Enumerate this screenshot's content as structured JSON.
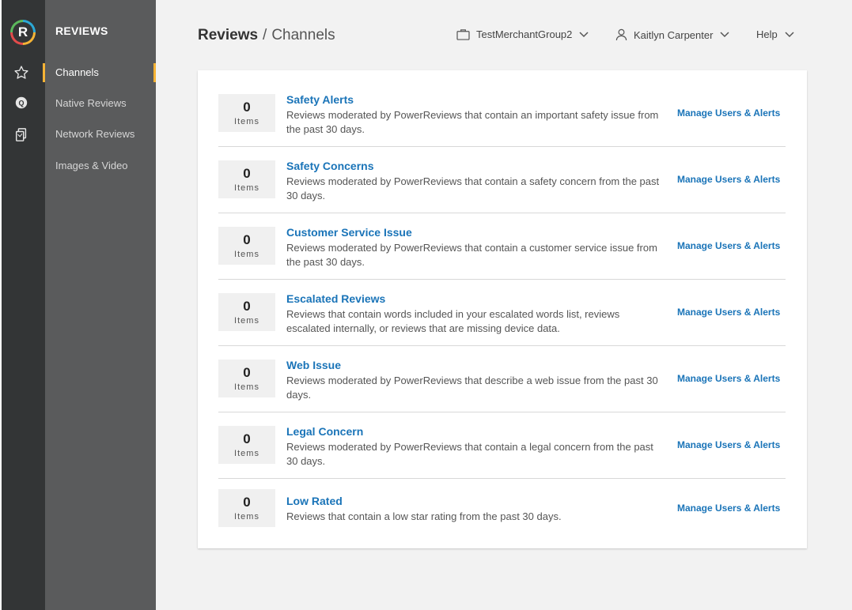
{
  "app": {
    "logo_letter": "R",
    "brand": "REVIEWS"
  },
  "nav": {
    "items": [
      {
        "label": "Channels",
        "active": true
      },
      {
        "label": "Native Reviews",
        "active": false
      },
      {
        "label": "Network Reviews",
        "active": false
      },
      {
        "label": "Images & Video",
        "active": false
      }
    ]
  },
  "header": {
    "title_main": "Reviews",
    "title_sep": "/",
    "title_sub": "Channels",
    "merchant": "TestMerchantGroup2",
    "user": "Kaitlyn Carpenter",
    "help": "Help"
  },
  "colors": {
    "accent": "#f5b335",
    "link": "#1a74b8",
    "sidebar_dark": "#333536",
    "sidebar_mid": "#5a5b5c"
  },
  "channels": {
    "items_label": "Items",
    "manage_label": "Manage Users & Alerts",
    "rows": [
      {
        "count": "0",
        "title": "Safety Alerts",
        "description": "Reviews moderated by PowerReviews that contain an important safety issue from the past 30 days."
      },
      {
        "count": "0",
        "title": "Safety Concerns",
        "description": "Reviews moderated by PowerReviews that contain a safety concern from the past 30 days."
      },
      {
        "count": "0",
        "title": "Customer Service Issue",
        "description": "Reviews moderated by PowerReviews that contain a customer service issue from the past 30 days."
      },
      {
        "count": "0",
        "title": "Escalated Reviews",
        "description": "Reviews that contain words included in your escalated words list, reviews escalated internally, or reviews that are missing device data."
      },
      {
        "count": "0",
        "title": "Web Issue",
        "description": "Reviews moderated by PowerReviews that describe a web issue from the past 30 days."
      },
      {
        "count": "0",
        "title": "Legal Concern",
        "description": "Reviews moderated by PowerReviews that contain a legal concern from the past 30 days."
      },
      {
        "count": "0",
        "title": "Low Rated",
        "description": "Reviews that contain a low star rating from the past 30 days."
      }
    ]
  }
}
